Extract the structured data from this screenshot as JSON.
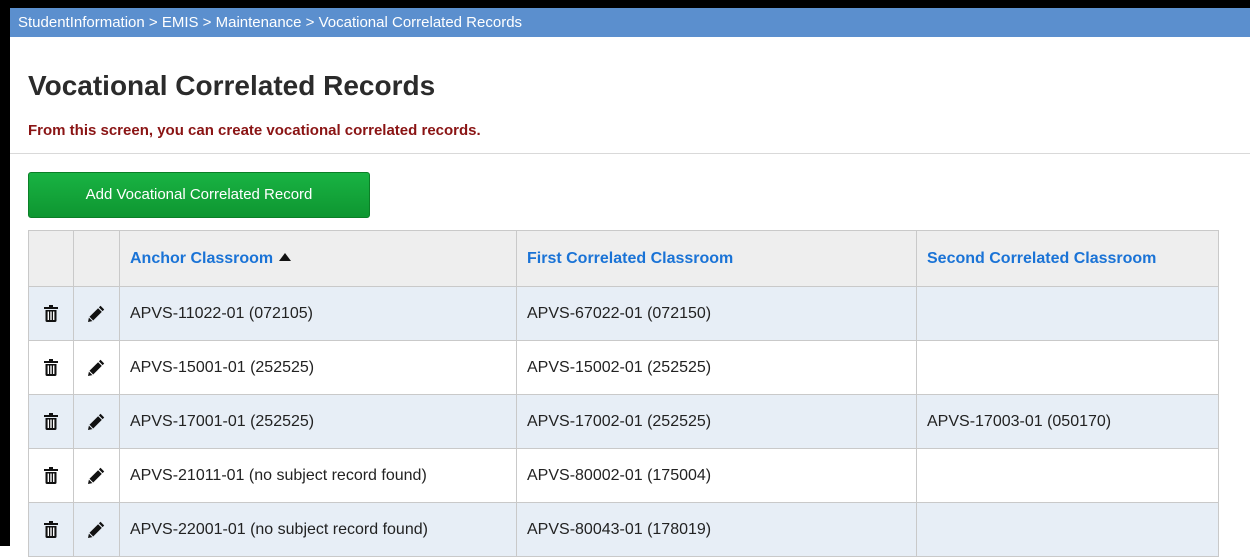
{
  "breadcrumb": "StudentInformation > EMIS > Maintenance > Vocational Correlated Records",
  "page": {
    "title": "Vocational Correlated Records",
    "subtitle": "From this screen, you can create vocational correlated records."
  },
  "actions": {
    "add_label": "Add Vocational Correlated Record"
  },
  "table": {
    "columns": [
      "Anchor Classroom",
      "First Correlated Classroom",
      "Second Correlated Classroom"
    ],
    "sorted_column": "Anchor Classroom",
    "sort_direction": "ascending",
    "rows": [
      {
        "anchor": "APVS-11022-01 (072105)",
        "first": "APVS-67022-01 (072150)",
        "second": ""
      },
      {
        "anchor": "APVS-15001-01 (252525)",
        "first": "APVS-15002-01 (252525)",
        "second": ""
      },
      {
        "anchor": "APVS-17001-01 (252525)",
        "first": "APVS-17002-01 (252525)",
        "second": "APVS-17003-01 (050170)"
      },
      {
        "anchor": "APVS-21011-01 (no subject record found)",
        "first": "APVS-80002-01 (175004)",
        "second": ""
      },
      {
        "anchor": "APVS-22001-01 (no subject record found)",
        "first": "APVS-80043-01 (178019)",
        "second": ""
      }
    ]
  },
  "icons": {
    "delete": "trash-icon",
    "edit": "pencil-icon"
  },
  "colors": {
    "breadcrumb_bg": "#5b8fce",
    "button_green": "#14a63a",
    "header_link": "#1a73d6",
    "subtitle_red": "#8a1414",
    "row_alt": "#e7eef6"
  }
}
